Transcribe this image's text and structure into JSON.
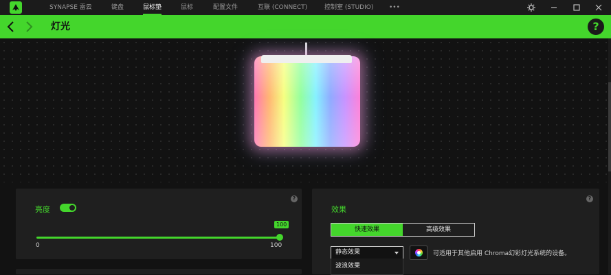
{
  "app": {
    "nav": [
      {
        "label": "SYNAPSE 雷云"
      },
      {
        "label": "键盘"
      },
      {
        "label": "鼠标垫"
      },
      {
        "label": "鼠标"
      },
      {
        "label": "配置文件"
      },
      {
        "label": "互联 (CONNECT)"
      },
      {
        "label": "控制室 (STUDIO)"
      },
      {
        "label": "•••"
      }
    ],
    "active_nav": "鼠标垫"
  },
  "header": {
    "title": "灯光",
    "help_label": "?"
  },
  "brightness_panel": {
    "label": "亮度",
    "enabled": true,
    "value_tip": "100",
    "min_label": "0",
    "max_label": "100",
    "value_fraction": 1.0,
    "info": "?"
  },
  "effects_panel": {
    "label": "效果",
    "info": "?",
    "tabs": [
      {
        "label": "快速效果"
      },
      {
        "label": "高级效果"
      }
    ],
    "selected_effect": "静态效果",
    "dropdown_options": [
      {
        "label": "波浪效果"
      }
    ],
    "chroma_note": "可适用于其他启用 Chroma幻彩灯光系统的设备。"
  },
  "colors": {
    "accent": "#44d62c",
    "bg": "#121212",
    "panel": "#1f1f1f"
  }
}
